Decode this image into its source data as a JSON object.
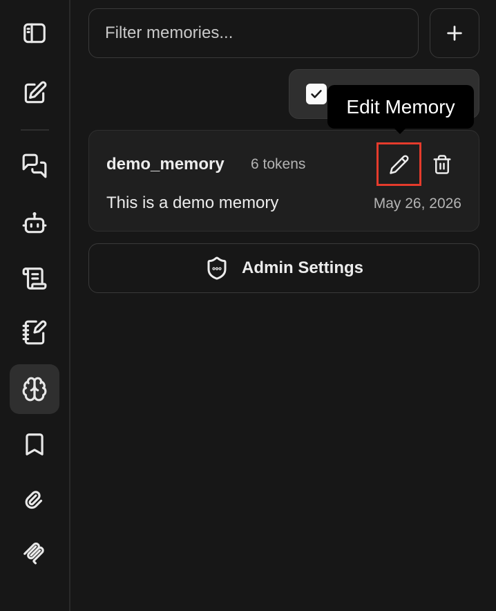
{
  "sidebar": {
    "items": [
      {
        "name": "toggle-sidebar",
        "icon": "sidebar-panel-icon"
      },
      {
        "name": "new-chat",
        "icon": "edit-square-icon"
      },
      {
        "name": "conversations",
        "icon": "chat-bubbles-icon"
      },
      {
        "name": "agents",
        "icon": "robot-icon"
      },
      {
        "name": "prompts",
        "icon": "scroll-icon"
      },
      {
        "name": "notes",
        "icon": "notebook-pen-icon"
      },
      {
        "name": "memories",
        "icon": "brain-icon",
        "active": true
      },
      {
        "name": "bookmarks",
        "icon": "bookmark-icon"
      },
      {
        "name": "attachments",
        "icon": "paperclip-icon"
      },
      {
        "name": "mcp",
        "icon": "mcp-icon"
      }
    ]
  },
  "search": {
    "placeholder": "Filter memories..."
  },
  "toolbar": {
    "add_icon": "plus-icon",
    "checkbox_checked": true
  },
  "tooltip": {
    "label": "Edit Memory"
  },
  "memory": {
    "key": "demo_memory",
    "tokens": "6 tokens",
    "value": "This is a demo memory",
    "date": "May 26, 2026",
    "edit_icon": "pencil-icon",
    "delete_icon": "trash-icon"
  },
  "admin": {
    "label": "Admin Settings",
    "icon": "shield-icon"
  },
  "colors": {
    "background": "#171717",
    "card": "#1f1f1f",
    "active_item": "#2f2f2f",
    "highlight": "#e53b2c",
    "tooltip": "#000000"
  }
}
